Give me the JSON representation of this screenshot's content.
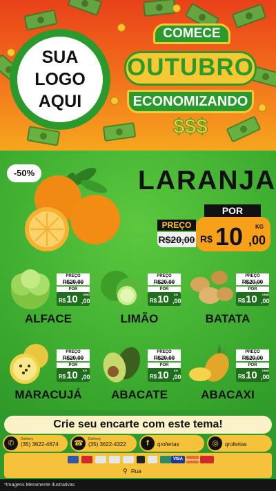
{
  "header": {
    "logo_lines": [
      "SUA",
      "LOGO",
      "AQUI"
    ],
    "comece": "COMECE",
    "month": "OUTUBRO",
    "subtitle": "ECONOMIZANDO",
    "money_symbols": "$$$"
  },
  "featured": {
    "discount": "-50%",
    "name": "LARANJA",
    "old_label": "PREÇO",
    "old_price": "R$20,00",
    "new_label": "POR",
    "currency": "R$",
    "price_int": "10",
    "price_cents": ",00",
    "unit": "KG"
  },
  "products": [
    {
      "name": "ALFACE",
      "old_label": "PREÇO",
      "old_price": "R$20,00",
      "new_label": "POR",
      "currency": "R$",
      "price_int": "10",
      "price_cents": ",00",
      "unit": "UNID"
    },
    {
      "name": "LIMÃO",
      "old_label": "PREÇO",
      "old_price": "R$20,00",
      "new_label": "POR",
      "currency": "R$",
      "price_int": "10",
      "price_cents": ",00",
      "unit": "KG"
    },
    {
      "name": "BATATA",
      "old_label": "PREÇO",
      "old_price": "R$20,00",
      "new_label": "POR",
      "currency": "R$",
      "price_int": "10",
      "price_cents": ",00",
      "unit": "UNID"
    },
    {
      "name": "MARACUJÁ",
      "old_label": "PREÇO",
      "old_price": "R$20,00",
      "new_label": "POR",
      "currency": "R$",
      "price_int": "10",
      "price_cents": ",00",
      "unit": "KG"
    },
    {
      "name": "ABACATE",
      "old_label": "PREÇO",
      "old_price": "R$20,00",
      "new_label": "POR",
      "currency": "R$",
      "price_int": "10",
      "price_cents": ",00",
      "unit": "KG"
    },
    {
      "name": "ABACAXI",
      "old_label": "PREÇO",
      "old_price": "R$20,00",
      "new_label": "POR",
      "currency": "R$",
      "price_int": "10",
      "price_cents": ",00",
      "unit": "UNID"
    }
  ],
  "cta": "Crie seu encarte com este tema!",
  "contacts": [
    {
      "icon": "whatsapp-icon",
      "small": "Delivery",
      "text": "(35) 3622-4674"
    },
    {
      "icon": "phone-icon",
      "small": "Delivery",
      "text": "(35) 3622-4322"
    },
    {
      "icon": "facebook-icon",
      "small": "",
      "text": "qrofertas"
    },
    {
      "icon": "instagram-icon",
      "small": "",
      "text": "qrofertas"
    }
  ],
  "payments": [
    "VISA",
    "MasterCard"
  ],
  "address": "Rua",
  "footer": "*Imagens Meramente Ilustrativas",
  "colors": {
    "header_red": "#e8411a",
    "header_orange": "#f6a71e",
    "green": "#2a9a2c",
    "yellow": "#f7c832",
    "price_orange": "#f7a11a"
  }
}
